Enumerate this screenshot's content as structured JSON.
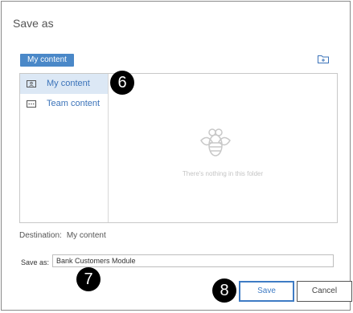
{
  "dialog": {
    "title": "Save as",
    "breadcrumb": "My content",
    "new_folder_icon": "new-folder-icon"
  },
  "sidebar": {
    "items": [
      {
        "label": "My content",
        "icon": "my-content-icon",
        "selected": true
      },
      {
        "label": "Team content",
        "icon": "team-content-icon",
        "selected": false
      }
    ]
  },
  "empty_state": {
    "icon": "bee-icon",
    "text": "There's nothing in this folder"
  },
  "destination": {
    "label": "Destination:",
    "value": "My content"
  },
  "save_as": {
    "label": "Save as:",
    "value": "Bank Customers Module"
  },
  "buttons": {
    "save": "Save",
    "cancel": "Cancel"
  },
  "callouts": [
    "6",
    "7",
    "8"
  ],
  "colors": {
    "accent": "#4a88c8",
    "selected_bg": "#dce8f5",
    "link": "#3b73b9"
  }
}
